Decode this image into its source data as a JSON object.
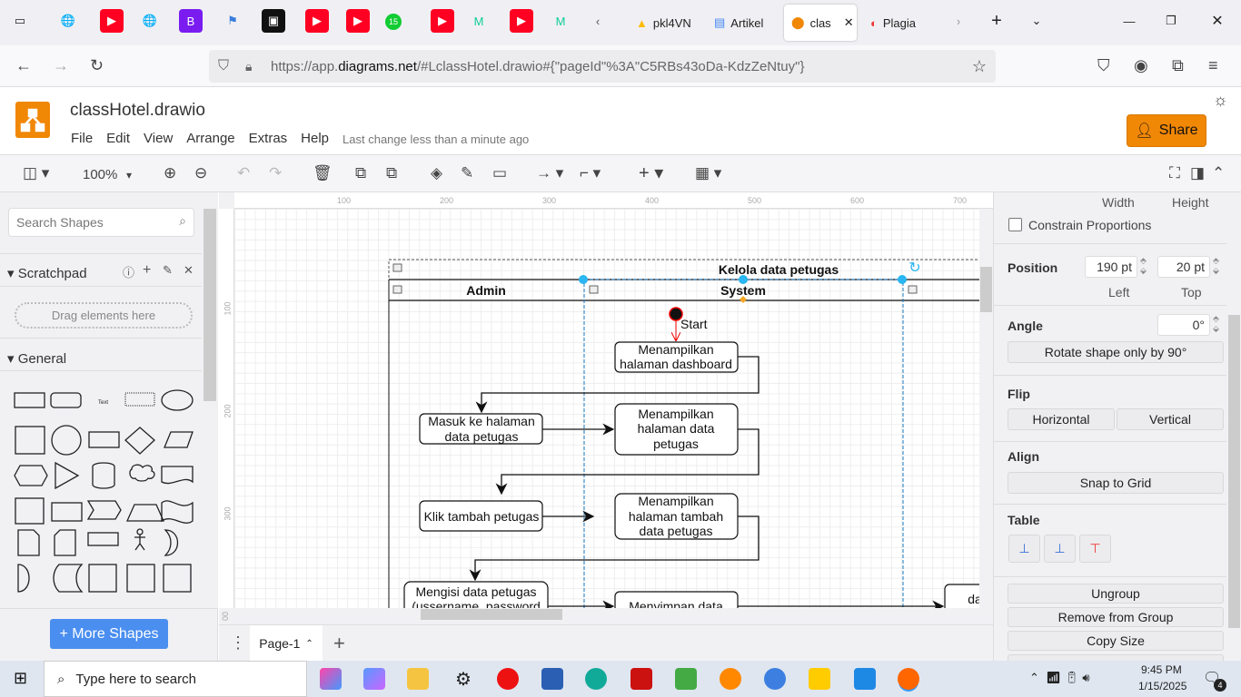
{
  "browser": {
    "pinned_tabs": [
      "youtube",
      "globe",
      "youtube",
      "globe",
      "B",
      "flag",
      "bookmark",
      "youtube",
      "youtube",
      "15",
      "youtube",
      "M",
      "youtube",
      "M"
    ],
    "tabs": [
      {
        "label": "pkl4VN",
        "icon": "google-drive-icon"
      },
      {
        "label": "Artikel",
        "icon": "google-docs-icon"
      },
      {
        "label": "clas",
        "icon": "drawio-icon",
        "active": true
      },
      {
        "label": "Plagia",
        "icon": "plagiarism-icon"
      }
    ],
    "url_prefix": "https://app.",
    "url_domain": "diagrams.net",
    "url_rest": "/#LclassHotel.drawio#{\"pageId\"%3A\"C5RBs43oDa-KdzZeNtuy\"}"
  },
  "app": {
    "title": "classHotel.drawio",
    "menu": [
      "File",
      "Edit",
      "View",
      "Arrange",
      "Extras",
      "Help"
    ],
    "last_change": "Last change less than a minute ago",
    "share_label": "Share",
    "brand_color": "#f08705"
  },
  "toolbar": {
    "zoom": "100%"
  },
  "sidebar": {
    "search_placeholder": "Search Shapes",
    "scratchpad": "Scratchpad",
    "drag_hint": "Drag elements here",
    "general": "General",
    "more_shapes": "+ More Shapes"
  },
  "ruler": {
    "top": [
      "100",
      "200",
      "300",
      "400",
      "500",
      "600",
      "700"
    ],
    "left": [
      "100",
      "200",
      "300",
      "00"
    ]
  },
  "diagram": {
    "title": "Kelola data petugas",
    "lanes": [
      "Admin",
      "System"
    ],
    "start_label": "Start",
    "nodes": {
      "dashboard": [
        "Menampilkan",
        "halaman dashboard"
      ],
      "masuk": [
        "Masuk ke halaman",
        "data petugas"
      ],
      "data_petugas": [
        "Menampilkan",
        "halaman data",
        "petugas"
      ],
      "klik": [
        "Klik tambah petugas"
      ],
      "tambah": [
        "Menampilkan",
        "halaman tambah",
        "data petugas"
      ],
      "mengisi": [
        "Mengisi data petugas",
        "(ussername, password"
      ],
      "menyimpan": [
        "Menyimpan data"
      ],
      "partial": [
        "da"
      ]
    }
  },
  "pages": {
    "current": "Page-1"
  },
  "format_panel": {
    "width_label": "Width",
    "height_label": "Height",
    "constrain": "Constrain Proportions",
    "position": "Position",
    "left_value": "190 pt",
    "top_value": "20 pt",
    "left_label": "Left",
    "top_label": "Top",
    "angle": "Angle",
    "angle_value": "0°",
    "rotate": "Rotate shape only by 90°",
    "flip": "Flip",
    "horizontal": "Horizontal",
    "vertical": "Vertical",
    "align": "Align",
    "snap": "Snap to Grid",
    "table": "Table",
    "ungroup": "Ungroup",
    "remove_group": "Remove from Group",
    "copy_size": "Copy Size"
  },
  "taskbar": {
    "search": "Type here to search",
    "time": "9:45 PM",
    "date": "1/15/2025",
    "notifications": "4"
  }
}
